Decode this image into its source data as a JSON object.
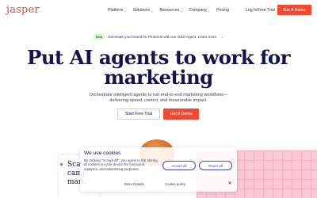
{
  "header": {
    "logo": "jasper",
    "nav": [
      {
        "label": "Platform",
        "chevron": "chevron-down-icon"
      },
      {
        "label": "Solutions",
        "chevron": "chevron-down-icon"
      },
      {
        "label": "Resources",
        "chevron": "chevron-down-icon"
      },
      {
        "label": "Company",
        "chevron": "chevron-down-icon"
      },
      {
        "label": "Pricing"
      }
    ],
    "login": "Log In",
    "free_trial": "Free Trial",
    "demo": "Get A Demo"
  },
  "announcement": {
    "badge": "New",
    "text": "Dominate your brand for Pinterest with our G&O Agent. Learn more",
    "icon": "arrow-right-icon"
  },
  "hero": {
    "title": "Put AI agents to work for marketing",
    "subtitle": "Orchestrate intelligent agents to run end-to-end marketing workflows— delivering speed, control, and measurable impact.",
    "primary_cta": "Start Free Trial",
    "secondary_cta": "Get A Demo"
  },
  "side_card": {
    "text": "Scale\ncamp\nmark"
  },
  "cookie": {
    "title": "We use cookies",
    "body": "By clicking \"Accept all\", you agree to the storing of cookies on your device for functional, analytics, and advertising purposes.",
    "accept": "Accept all",
    "reject": "Reject all",
    "details": "More Details",
    "policy": "Cookie policy",
    "close_icon": "close-icon"
  },
  "colors": {
    "brand": "#e5483a",
    "cta": "#ef4a33",
    "heading": "#15134d",
    "cookie_button": "#3e4bb8"
  }
}
